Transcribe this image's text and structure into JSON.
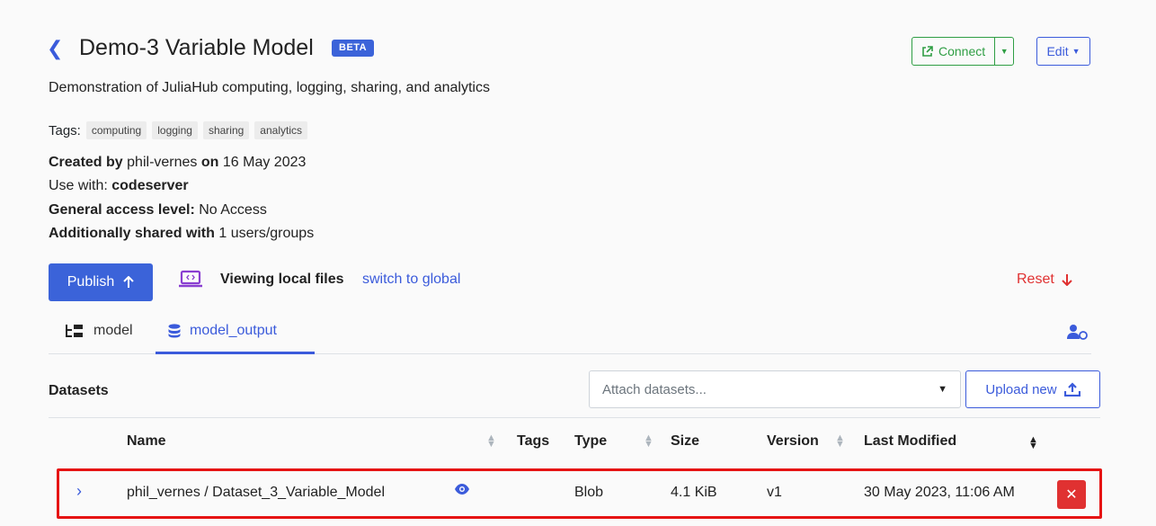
{
  "header": {
    "back_icon": "chevron-left-icon",
    "title": "Demo-3 Variable Model",
    "badge": "BETA",
    "description": "Demonstration of JuliaHub computing, logging, sharing, and analytics",
    "connect_label": "Connect",
    "edit_label": "Edit"
  },
  "details": {
    "tags_label": "Tags:",
    "tags": [
      "computing",
      "logging",
      "sharing",
      "analytics"
    ],
    "created_by_label": "Created by",
    "created_by_user": "phil-vernes",
    "created_on_label": "on",
    "created_date": "16 May 2023",
    "use_with_label": "Use with:",
    "use_with_value": "codeserver",
    "access_label": "General access level:",
    "access_value": "No Access",
    "shared_label": "Additionally shared with",
    "shared_value": "1 users/groups"
  },
  "actions": {
    "publish_label": "Publish",
    "viewing_label": "Viewing local files",
    "switch_label": "switch to global",
    "reset_label": "Reset"
  },
  "tabs": [
    {
      "label": "model",
      "icon": "file-tree-icon"
    },
    {
      "label": "model_output",
      "icon": "database-icon"
    }
  ],
  "datasets": {
    "label": "Datasets",
    "attach_placeholder": "Attach datasets...",
    "upload_label": "Upload new",
    "columns": [
      "Name",
      "Tags",
      "Type",
      "Size",
      "Version",
      "Last Modified"
    ],
    "rows": [
      {
        "name": "phil_vernes / Dataset_3_Variable_Model",
        "tags": "",
        "type": "Blob",
        "size": "4.1 KiB",
        "version": "v1",
        "last_modified": "30 May 2023, 11:06 AM"
      }
    ]
  },
  "colors": {
    "primary": "#3b63d9",
    "success": "#2f9e44",
    "danger": "#e03131",
    "highlight": "#e61414"
  }
}
